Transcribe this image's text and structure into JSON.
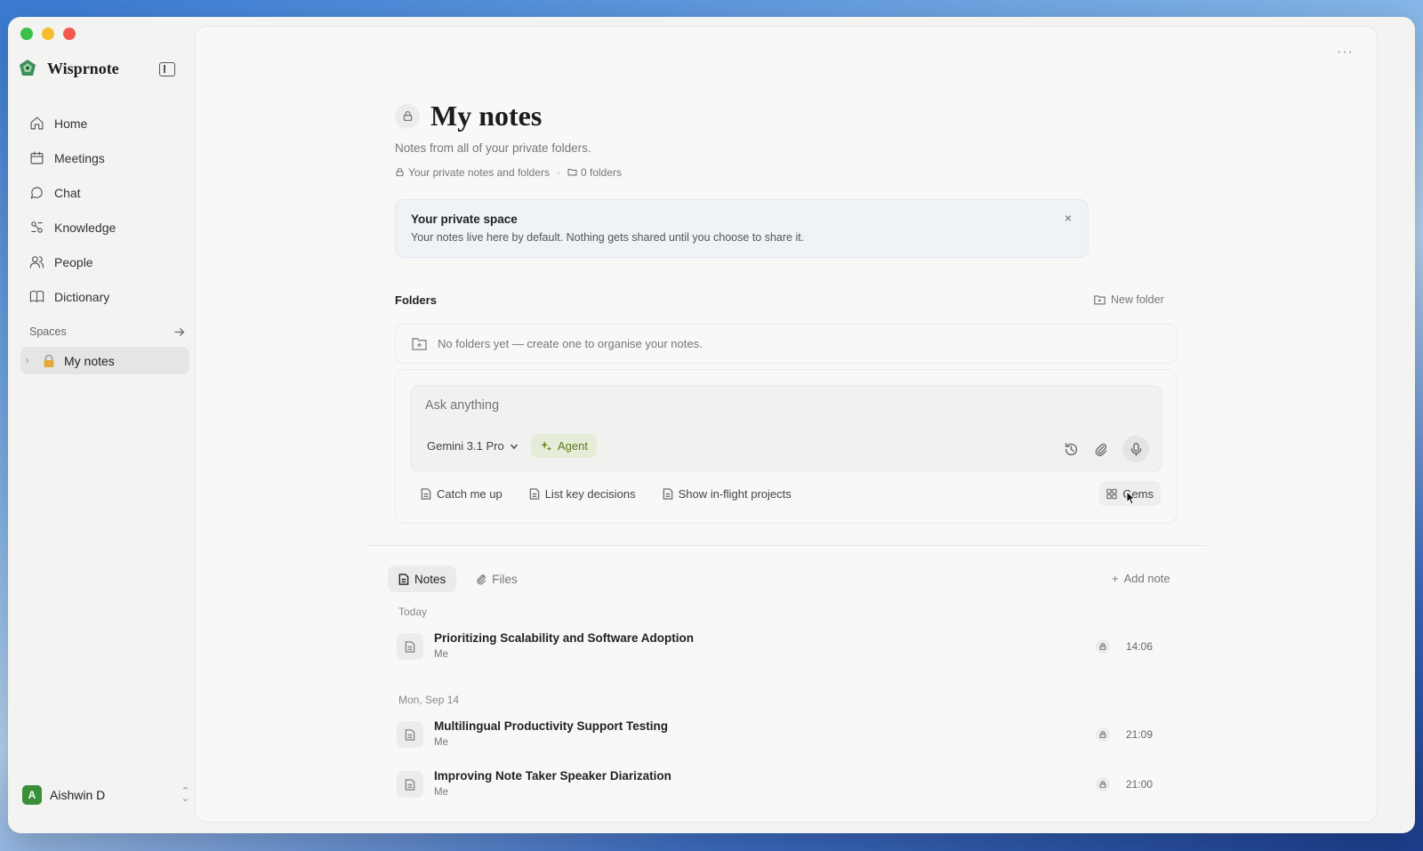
{
  "app": {
    "name": "Wisprnote"
  },
  "sidebar": {
    "items": [
      {
        "label": "Home",
        "icon": "home-icon"
      },
      {
        "label": "Meetings",
        "icon": "calendar-icon"
      },
      {
        "label": "Chat",
        "icon": "chat-icon"
      },
      {
        "label": "Knowledge",
        "icon": "knowledge-icon"
      },
      {
        "label": "People",
        "icon": "people-icon"
      },
      {
        "label": "Dictionary",
        "icon": "book-icon"
      }
    ],
    "spaces_label": "Spaces",
    "space_item": "My notes",
    "user": {
      "initial": "A",
      "name": "Aishwin D"
    }
  },
  "page": {
    "title": "My notes",
    "subtitle": "Notes from all of your private folders.",
    "meta_private": "Your private notes and folders",
    "meta_separator": "·",
    "meta_folders": "0 folders"
  },
  "banner": {
    "title": "Your private space",
    "text": "Your notes live here by default. Nothing gets shared until you choose to share it.",
    "close": "×"
  },
  "folders": {
    "label": "Folders",
    "new_folder": "New folder",
    "empty": "No folders yet — create one to organise your notes."
  },
  "ask": {
    "placeholder": "Ask anything",
    "model": "Gemini 3.1 Pro",
    "agent": "Agent",
    "suggestions": [
      "Catch me up",
      "List key decisions",
      "Show in-flight projects"
    ],
    "gems": "Gems"
  },
  "tabs": {
    "notes": "Notes",
    "files": "Files",
    "add_note": "Add note"
  },
  "groups": [
    {
      "label": "Today",
      "notes": [
        {
          "title": "Prioritizing Scalability and Software Adoption",
          "author": "Me",
          "time": "14:06"
        }
      ]
    },
    {
      "label": "Mon, Sep 14",
      "notes": [
        {
          "title": "Multilingual Productivity Support Testing",
          "author": "Me",
          "time": "21:09"
        },
        {
          "title": "Improving Note Taker Speaker Diarization",
          "author": "Me",
          "time": "21:00"
        }
      ]
    }
  ],
  "colors": {
    "accent": "#6b8e23",
    "agent_bg": "#e5ecd7",
    "banner_bg": "#eef3f6",
    "avatar": "#3a8f3a"
  }
}
